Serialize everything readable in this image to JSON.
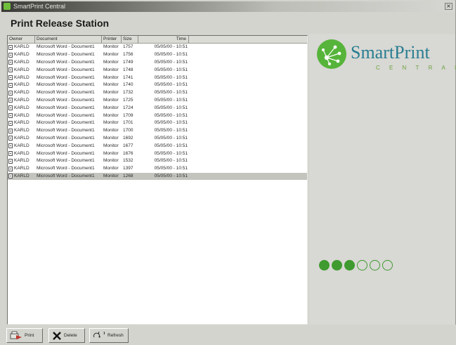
{
  "window": {
    "title": "SmartPrint Central",
    "close_glyph": "×"
  },
  "heading": "Print Release Station",
  "columns": {
    "owner": "Owner",
    "document": "Document",
    "printer": "Printer",
    "size": "Size",
    "time": "Time"
  },
  "jobs": [
    {
      "owner": "KARLD",
      "document": "Microsoft Word - Document1",
      "printer": "Monitor",
      "size": "1757",
      "time": "05/05/00 - 10:51"
    },
    {
      "owner": "KARLD",
      "document": "Microsoft Word - Document1",
      "printer": "Monitor",
      "size": "1756",
      "time": "05/05/00 - 10:51"
    },
    {
      "owner": "KARLD",
      "document": "Microsoft Word - Document1",
      "printer": "Monitor",
      "size": "1749",
      "time": "05/05/00 - 10:51"
    },
    {
      "owner": "KARLD",
      "document": "Microsoft Word - Document1",
      "printer": "Monitor",
      "size": "1748",
      "time": "05/05/00 - 10:51"
    },
    {
      "owner": "KARLD",
      "document": "Microsoft Word - Document1",
      "printer": "Monitor",
      "size": "1741",
      "time": "05/05/00 - 10:51"
    },
    {
      "owner": "KARLD",
      "document": "Microsoft Word - Document1",
      "printer": "Monitor",
      "size": "1740",
      "time": "05/05/00 - 10:51"
    },
    {
      "owner": "KARLD",
      "document": "Microsoft Word - Document1",
      "printer": "Monitor",
      "size": "1732",
      "time": "05/05/00 - 10:51"
    },
    {
      "owner": "KARLD",
      "document": "Microsoft Word - Document1",
      "printer": "Monitor",
      "size": "1725",
      "time": "05/05/00 - 10:51"
    },
    {
      "owner": "KARLD",
      "document": "Microsoft Word - Document1",
      "printer": "Monitor",
      "size": "1724",
      "time": "05/05/00 - 10:51"
    },
    {
      "owner": "KARLD",
      "document": "Microsoft Word - Document1",
      "printer": "Monitor",
      "size": "1709",
      "time": "05/05/00 - 10:51"
    },
    {
      "owner": "KARLD",
      "document": "Microsoft Word - Document1",
      "printer": "Monitor",
      "size": "1701",
      "time": "05/05/00 - 10:51"
    },
    {
      "owner": "KARLD",
      "document": "Microsoft Word - Document1",
      "printer": "Monitor",
      "size": "1700",
      "time": "05/05/00 - 10:51"
    },
    {
      "owner": "KARLD",
      "document": "Microsoft Word - Document1",
      "printer": "Monitor",
      "size": "1692",
      "time": "05/05/00 - 10:51"
    },
    {
      "owner": "KARLD",
      "document": "Microsoft Word - Document1",
      "printer": "Monitor",
      "size": "1677",
      "time": "05/05/00 - 10:51"
    },
    {
      "owner": "KARLD",
      "document": "Microsoft Word - Document1",
      "printer": "Monitor",
      "size": "1676",
      "time": "05/05/00 - 10:51"
    },
    {
      "owner": "KARLD",
      "document": "Microsoft Word - Document1",
      "printer": "Monitor",
      "size": "1532",
      "time": "05/05/00 - 10:51"
    },
    {
      "owner": "KARLD",
      "document": "Microsoft Word - Document1",
      "printer": "Monitor",
      "size": "1397",
      "time": "05/05/00 - 10:51"
    },
    {
      "owner": "KARLD",
      "document": "Microsoft Word - Document1",
      "printer": "Monitor",
      "size": "1268",
      "time": "05/05/00 - 10:51"
    }
  ],
  "selected_row": 17,
  "brand": {
    "name": "SmartPrint",
    "subtitle": "CENTRAL",
    "logo_icon": "network-node-icon"
  },
  "progress": {
    "filled": 3,
    "total": 6,
    "color": "#3f9a2f"
  },
  "toolbar": {
    "print_label": "Print",
    "delete_label": "Delete",
    "refresh_label": "Refresh"
  },
  "colors": {
    "logo_green": "#56b43a",
    "brand_text": "#2a7d92",
    "subtitle_green": "#6aa23c",
    "print_arrow": "#c0342a"
  }
}
